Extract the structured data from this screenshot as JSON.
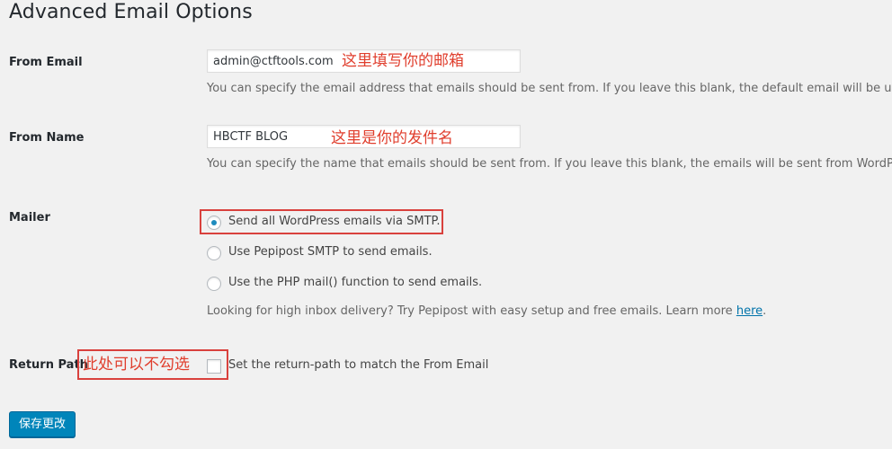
{
  "page_title": "Advanced Email Options",
  "from_email": {
    "label": "From Email",
    "value": "admin@ctftools.com",
    "annotation": "这里填写你的邮箱",
    "description": "You can specify the email address that emails should be sent from. If you leave this blank, the default email will be used."
  },
  "from_name": {
    "label": "From Name",
    "value": "HBCTF BLOG",
    "annotation": "这里是你的发件名",
    "description": "You can specify the name that emails should be sent from. If you leave this blank, the emails will be sent from WordPress."
  },
  "mailer": {
    "label": "Mailer",
    "options": [
      {
        "label": "Send all WordPress emails via SMTP.",
        "checked": true
      },
      {
        "label": "Use Pepipost SMTP to send emails.",
        "checked": false
      },
      {
        "label": "Use the PHP mail() function to send emails.",
        "checked": false
      }
    ],
    "hint_prefix": "Looking for high inbox delivery? Try Pepipost with easy setup and free emails. Learn more ",
    "hint_link": "here",
    "hint_suffix": "."
  },
  "return_path": {
    "label": "Return Path",
    "annotation": "此处可以不勾选",
    "checkbox_label": "Set the return-path to match the From Email",
    "checked": false
  },
  "submit_button": "保存更改",
  "colors": {
    "annotation_red": "#e03e2d",
    "primary_button": "#0085ba",
    "link": "#0073aa"
  }
}
